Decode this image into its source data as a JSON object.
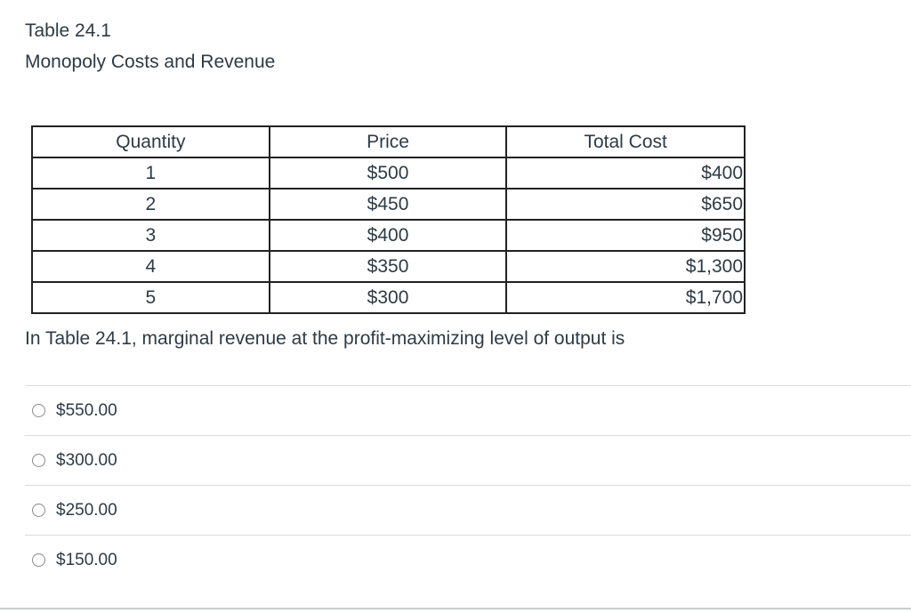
{
  "caption": {
    "title": "Table 24.1",
    "subtitle": "Monopoly Costs and Revenue"
  },
  "table": {
    "headers": [
      "Quantity",
      "Price",
      "Total Cost"
    ],
    "rows": [
      [
        "1",
        "$500",
        "$400"
      ],
      [
        "2",
        "$450",
        "$650"
      ],
      [
        "3",
        "$400",
        "$950"
      ],
      [
        "4",
        "$350",
        "$1,300"
      ],
      [
        "5",
        "$300",
        "$1,700"
      ]
    ]
  },
  "question": {
    "text": "In Table 24.1, marginal revenue at the profit-maximizing level of output is"
  },
  "answers": [
    {
      "label": "$550.00"
    },
    {
      "label": "$300.00"
    },
    {
      "label": "$250.00"
    },
    {
      "label": "$150.00"
    }
  ]
}
